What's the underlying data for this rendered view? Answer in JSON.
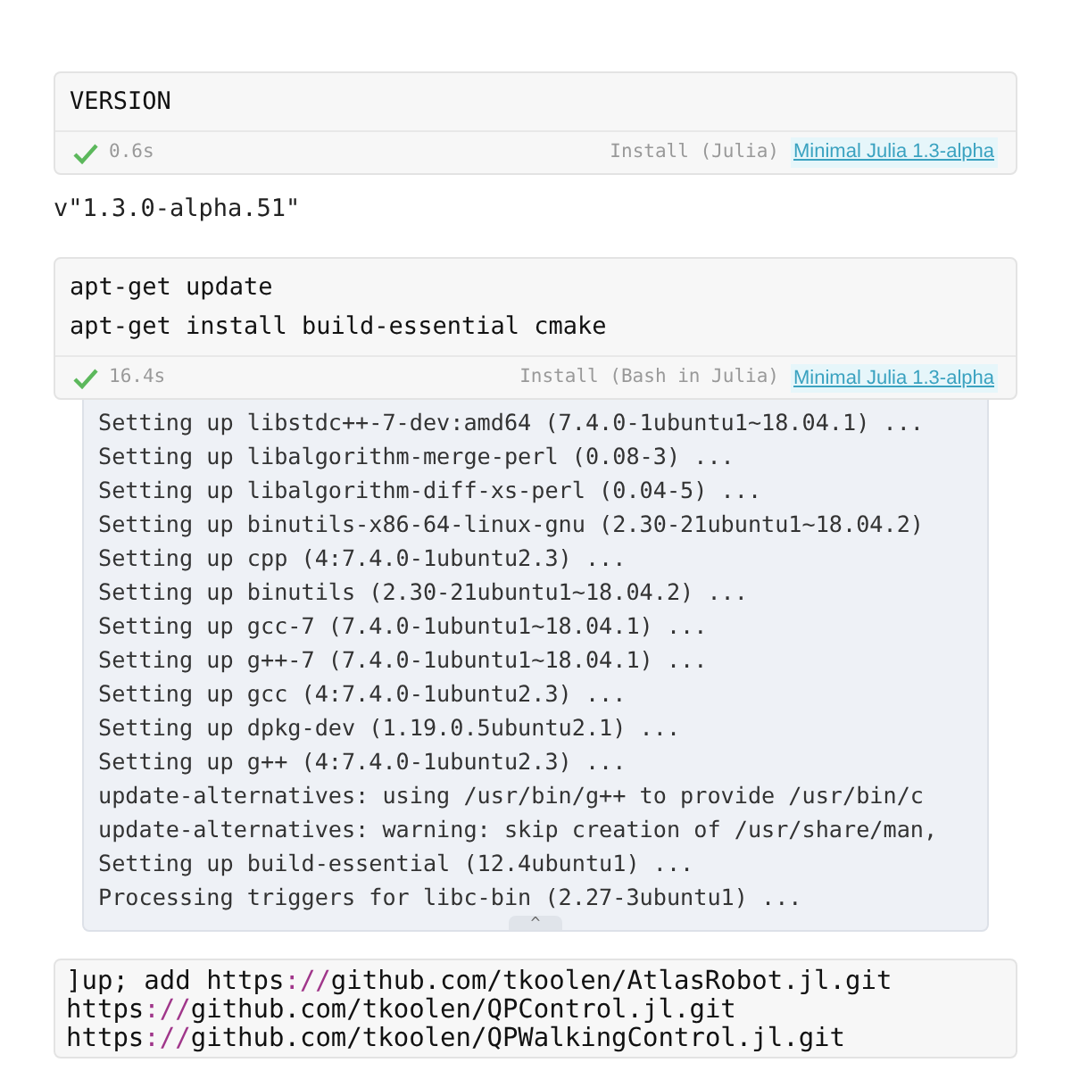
{
  "cells": [
    {
      "code": [
        "VERSION"
      ],
      "succeeded": true,
      "time": "0.6s",
      "runner": "Install (Julia)",
      "environment": "Minimal Julia 1.3-alpha",
      "output": {
        "kind": "plain",
        "lines": [
          "v\"1.3.0-alpha.51\""
        ]
      }
    },
    {
      "code": [
        "apt-get update",
        "apt-get install build-essential cmake"
      ],
      "succeeded": true,
      "time": "16.4s",
      "runner": "Install (Bash in Julia)",
      "environment": "Minimal Julia 1.3-alpha",
      "output": {
        "kind": "log",
        "lines": [
          "Setting up libstdc++-7-dev:amd64 (7.4.0-1ubuntu1~18.04.1) ...",
          "Setting up libalgorithm-merge-perl (0.08-3) ...",
          "Setting up libalgorithm-diff-xs-perl (0.04-5) ...",
          "Setting up binutils-x86-64-linux-gnu (2.30-21ubuntu1~18.04.2)",
          "Setting up cpp (4:7.4.0-1ubuntu2.3) ...",
          "Setting up binutils (2.30-21ubuntu1~18.04.2) ...",
          "Setting up gcc-7 (7.4.0-1ubuntu1~18.04.1) ...",
          "Setting up g++-7 (7.4.0-1ubuntu1~18.04.1) ...",
          "Setting up gcc (4:7.4.0-1ubuntu2.3) ...",
          "Setting up dpkg-dev (1.19.0.5ubuntu2.1) ...",
          "Setting up g++ (4:7.4.0-1ubuntu2.3) ...",
          "update-alternatives: using /usr/bin/g++ to provide /usr/bin/c",
          "update-alternatives: warning: skip creation of /usr/share/man,",
          "Setting up build-essential (12.4ubuntu1) ...",
          "Processing triggers for libc-bin (2.27-3ubuntu1) ..."
        ],
        "collapse_icon": "^"
      }
    }
  ],
  "last_cell": {
    "lines": [
      [
        {
          "kind": "plain",
          "text": "]up; add https"
        },
        {
          "kind": "punct",
          "text": "://"
        },
        {
          "kind": "plain",
          "text": "github.com/tkoolen/AtlasRobot.jl.git"
        }
      ],
      [
        {
          "kind": "plain",
          "text": "https"
        },
        {
          "kind": "punct",
          "text": "://"
        },
        {
          "kind": "plain",
          "text": "github.com/tkoolen/QPControl.jl.git"
        }
      ],
      [
        {
          "kind": "plain",
          "text": "https"
        },
        {
          "kind": "punct",
          "text": "://"
        },
        {
          "kind": "plain",
          "text": "github.com/tkoolen/QPWalkingControl.jl.git"
        }
      ]
    ]
  }
}
